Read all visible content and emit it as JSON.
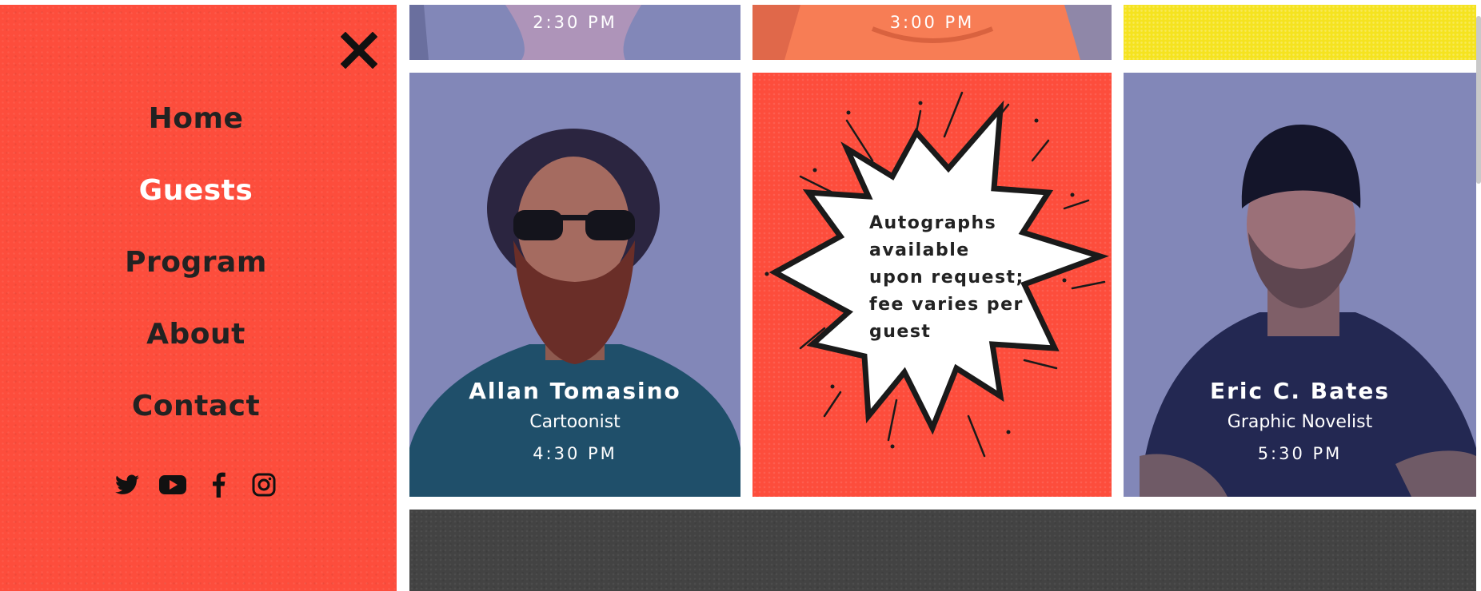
{
  "menu": {
    "background": "#fd4d3c",
    "close_icon": "close-x-icon",
    "items": [
      {
        "label": "Home",
        "active": false
      },
      {
        "label": "Guests",
        "active": true
      },
      {
        "label": "Program",
        "active": false
      },
      {
        "label": "About",
        "active": false
      },
      {
        "label": "Contact",
        "active": false
      }
    ],
    "social": [
      "twitter-icon",
      "youtube-icon",
      "facebook-icon",
      "instagram-icon"
    ]
  },
  "top_row": [
    {
      "time": "2:30 PM"
    },
    {
      "time": "3:00 PM"
    }
  ],
  "guests": [
    {
      "name": "Allan Tomasino",
      "role": "Cartoonist",
      "time": "4:30 PM"
    },
    {
      "name": "Eric C. Bates",
      "role": "Graphic Novelist",
      "time": "5:30 PM"
    }
  ],
  "promo": {
    "text": "Autographs available upon request; fee varies per guest"
  },
  "colors": {
    "accent_red": "#fd4d3c",
    "tile_purple": "#8287b8",
    "tile_yellow": "#f5e31f",
    "footer_dark": "#434343",
    "text_dark": "#222222"
  }
}
